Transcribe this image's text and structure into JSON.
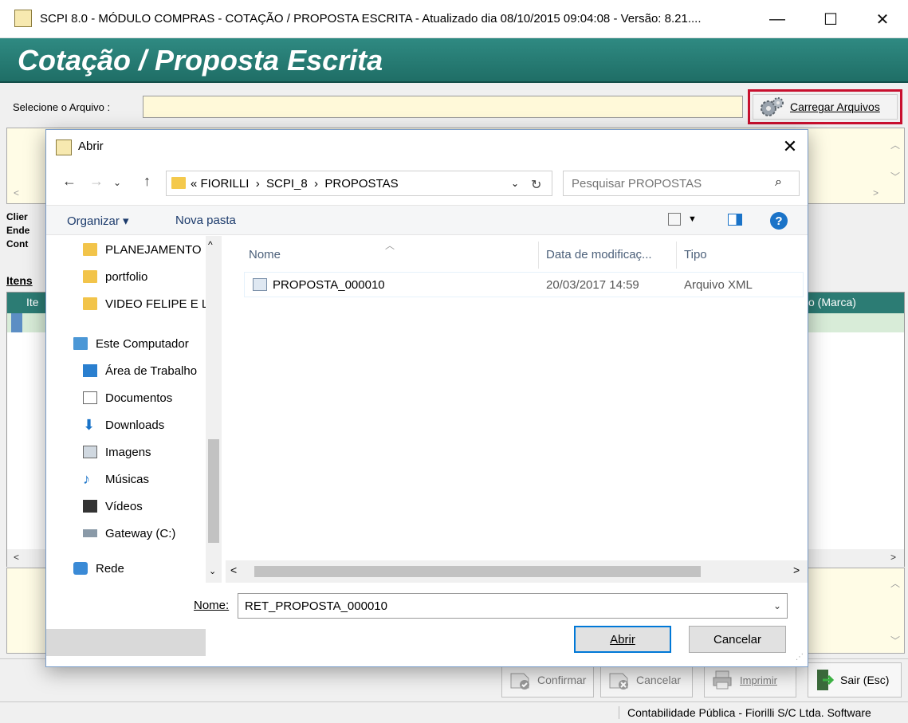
{
  "window": {
    "title": "SCPI 8.0 - MÓDULO COMPRAS - COTAÇÃO / PROPOSTA ESCRITA - Atualizado dia 08/10/2015 09:04:08 - Versão: 8.21....",
    "minimize_glyph": "—",
    "maximize_glyph": "☐",
    "close_glyph": "✕"
  },
  "header": {
    "title": "Cotação / Proposta Escrita"
  },
  "file_selector": {
    "label": "Selecione o Arquivo :",
    "value": "",
    "load_button": "Carregar Arquivos"
  },
  "client_info": {
    "line1": "Clier",
    "line2": "Ende",
    "line3": "Cont"
  },
  "items": {
    "tab": "Itens",
    "col_item": "Ite",
    "col_marca": "o (Marca)"
  },
  "toolbar": {
    "confirm": "Confirmar",
    "cancel": "Cancelar",
    "print": "Imprimir",
    "exit": "Sair (Esc)"
  },
  "status_bar": {
    "text": "Contabilidade Pública - Fiorilli S/C Ltda. Software"
  },
  "dialog": {
    "title": "Abrir",
    "close_glyph": "✕",
    "address": "« FIORILLI  ›  SCPI_8  ›  PROPOSTAS",
    "search_placeholder": "Pesquisar PROPOSTAS",
    "organize": "Organizar ▾",
    "new_folder": "Nova pasta",
    "nav_items": [
      {
        "label": "PLANEJAMENTO",
        "icon": "folder-check-icon"
      },
      {
        "label": "portfolio",
        "icon": "folder-error-icon"
      },
      {
        "label": "VIDEO FELIPE E L",
        "icon": "folder-error-icon"
      },
      {
        "label": "Este Computador",
        "icon": "computer-icon"
      },
      {
        "label": "Área de Trabalho",
        "icon": "desktop-icon"
      },
      {
        "label": "Documentos",
        "icon": "documents-icon"
      },
      {
        "label": "Downloads",
        "icon": "downloads-icon"
      },
      {
        "label": "Imagens",
        "icon": "images-icon"
      },
      {
        "label": "Músicas",
        "icon": "music-icon"
      },
      {
        "label": "Vídeos",
        "icon": "videos-icon"
      },
      {
        "label": "Gateway (C:)",
        "icon": "drive-icon"
      },
      {
        "label": "Rede",
        "icon": "network-icon"
      }
    ],
    "columns": {
      "name": "Nome",
      "date": "Data de modificaç...",
      "type": "Tipo"
    },
    "files": [
      {
        "name": "PROPOSTA_000010",
        "date": "20/03/2017 14:59",
        "type": "Arquivo XML"
      }
    ],
    "filename_label": "Nome:",
    "filename_value": "RET_PROPOSTA_000010",
    "open_button": "Abrir",
    "cancel_button": "Cancelar"
  }
}
